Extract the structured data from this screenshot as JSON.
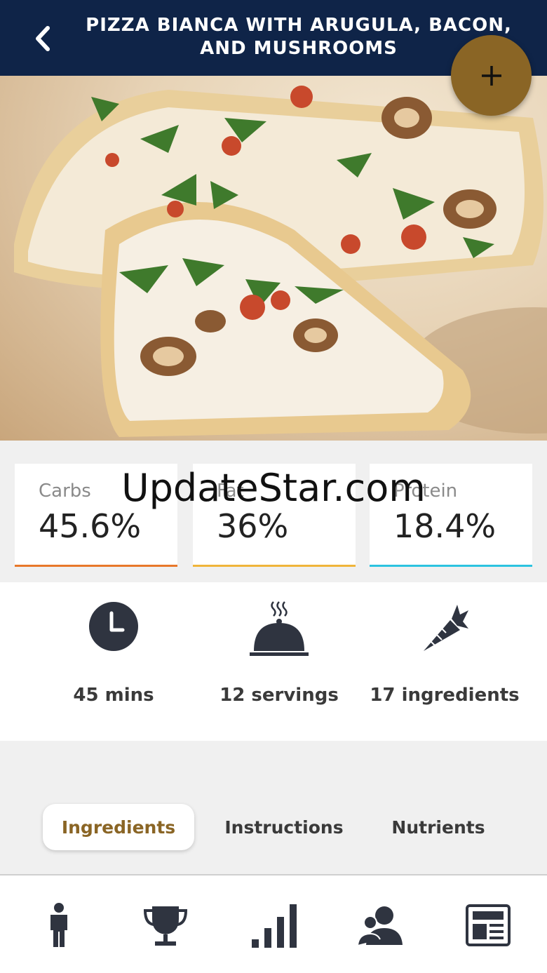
{
  "header": {
    "title": "PIZZA BIANCA WITH ARUGULA, BACON, AND MUSHROOMS",
    "back_icon": "chevron-left-icon",
    "add_icon": "plus-icon"
  },
  "macros": [
    {
      "label": "Carbs",
      "value": "45.6%",
      "color": "#e8782a"
    },
    {
      "label": "Fat",
      "value": "36%",
      "color": "#f0b53a"
    },
    {
      "label": "Protein",
      "value": "18.4%",
      "color": "#2cc3e0"
    }
  ],
  "watermark": "UpdateStar.com",
  "stats": [
    {
      "icon": "clock-icon",
      "label": "45 mins"
    },
    {
      "icon": "serving-dish-icon",
      "label": "12 servings"
    },
    {
      "icon": "carrot-icon",
      "label": "17 ingredients"
    }
  ],
  "tabs": [
    {
      "label": "Ingredients",
      "active": true
    },
    {
      "label": "Instructions",
      "active": false
    },
    {
      "label": "Nutrients",
      "active": false
    }
  ],
  "bottom_nav": [
    {
      "icon": "person-icon"
    },
    {
      "icon": "trophy-icon"
    },
    {
      "icon": "bar-chart-icon"
    },
    {
      "icon": "users-icon"
    },
    {
      "icon": "newspaper-icon"
    }
  ],
  "colors": {
    "header_bg": "#0f2448",
    "accent_gold": "#8a6525",
    "icon_dark": "#2f3440"
  }
}
